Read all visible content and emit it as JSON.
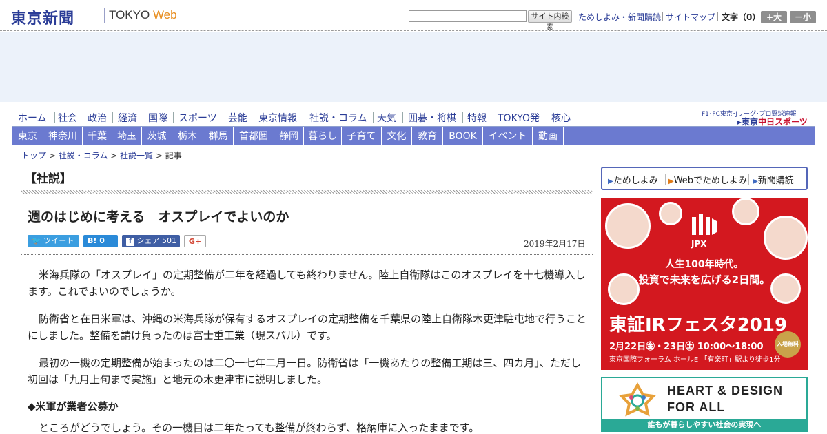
{
  "header": {
    "logo": "東京新聞",
    "logo_sub": "TOKYO",
    "logo_web": "Web",
    "search_placeholder": "",
    "search_button": "サイト内検索",
    "links": [
      "ためしよみ・新聞購読",
      "サイトマップ"
    ],
    "font_size_label": "文字（0）",
    "font_larger": "+大",
    "font_smaller": "－小"
  },
  "global_nav": {
    "items": [
      "ホーム",
      "社会",
      "政治",
      "経済",
      "国際",
      "スポーツ",
      "芸能",
      "東京情報",
      "社説・コラム",
      "天気",
      "囲碁・将棋",
      "特報",
      "TOKYO発",
      "核心"
    ],
    "chunichi_small": "F1･FC東京･Jリーグ･プロ野球速報",
    "chunichi_prefix": "▸東京",
    "chunichi_brand": "中日スポーツ"
  },
  "local_nav": {
    "items": [
      "東京",
      "神奈川",
      "千葉",
      "埼玉",
      "茨城",
      "栃木",
      "群馬",
      "首都圏",
      "静岡",
      "暮らし",
      "子育て",
      "文化",
      "教育",
      "BOOK",
      "イベント",
      "動画"
    ]
  },
  "breadcrumb": {
    "items": [
      "トップ",
      "社説・コラム",
      "社説一覧"
    ],
    "current": "記事"
  },
  "article": {
    "category": "【社説】",
    "title": "週のはじめに考える　オスプレイでよいのか",
    "share": {
      "twitter": "ツイート",
      "hatena": "B!",
      "hatena_count": "0",
      "facebook": "シェア",
      "facebook_count": "501",
      "gplus": "G+"
    },
    "date": "2019年2月17日",
    "paragraphs": [
      "米海兵隊の「オスプレイ」の定期整備が二年を経過しても終わりません。陸上自衛隊はこのオスプレイを十七機導入します。これでよいのでしょうか。",
      "防衛省と在日米軍は、沖縄の米海兵隊が保有するオスプレイの定期整備を千葉県の陸上自衛隊木更津駐屯地で行うことにしました。整備を請け負ったのは富士重工業（現スバル）です。",
      "最初の一機の定期整備が始まったのは二〇一七年二月一日。防衛省は「一機あたりの整備工期は三、四カ月」、ただし初回は「九月上旬まで実施」と地元の木更津市に説明しました。"
    ],
    "subhead": "◆米軍が業者公募か",
    "paragraph_4": "ところがどうでしょう。その一機目は二年たっても整備が終わらず、格納庫に入ったままです。"
  },
  "sidebar": {
    "links": [
      "ためしよみ",
      "Webでためしよみ",
      "新聞購読"
    ],
    "ad_jpx": {
      "logo": "JPX",
      "line1": "人生100年時代。",
      "line2": "投資で未来を広げる2日間。",
      "fest": "東証IRフェスタ2019",
      "date": "2月22日㊎・23日㊏ 10:00～18:00",
      "venue": "東京国際フォーラム ホールE 「有楽町」駅より徒歩1分",
      "free": "入場無料"
    },
    "ad_heart": {
      "title1": "HEART & DESIGN",
      "title2": "FOR ALL",
      "bar": "誰もが暮らしやすい社会の実現へ"
    }
  },
  "colors": {
    "brand": "#2b3d97",
    "local_nav": "#6b7ad0",
    "jpx_red": "#d3181f",
    "heart_green": "#2aa996"
  }
}
